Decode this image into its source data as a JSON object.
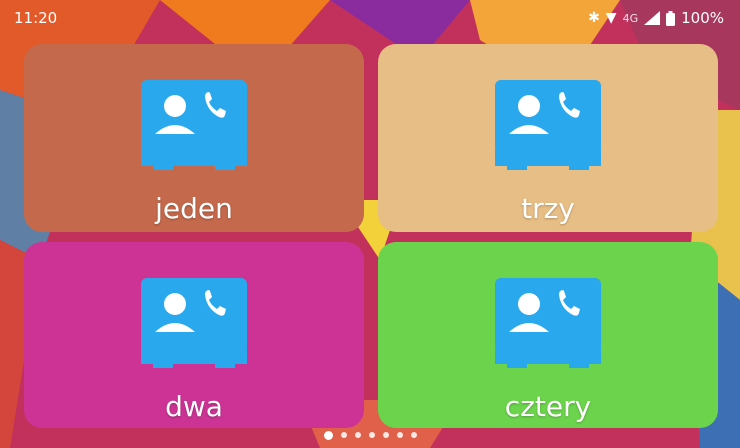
{
  "status_bar": {
    "time": "11:20",
    "network": "4G",
    "battery": "100%",
    "icons": [
      "bluetooth-icon",
      "wifi-icon",
      "signal-icon",
      "battery-icon"
    ]
  },
  "tiles": [
    {
      "label": "jeden",
      "color": "#c5694c",
      "icon": "contact-phone-icon"
    },
    {
      "label": "trzy",
      "color": "#e7be85",
      "icon": "contact-phone-icon"
    },
    {
      "label": "dwa",
      "color": "#cc3394",
      "icon": "contact-phone-icon"
    },
    {
      "label": "cztery",
      "color": "#6cd44c",
      "icon": "contact-phone-icon"
    }
  ],
  "page_indicator": {
    "pages": 7,
    "current": 1
  },
  "colors": {
    "icon_blue": "#2aa8ee",
    "icon_blue_dark": "#1d8fd4"
  }
}
